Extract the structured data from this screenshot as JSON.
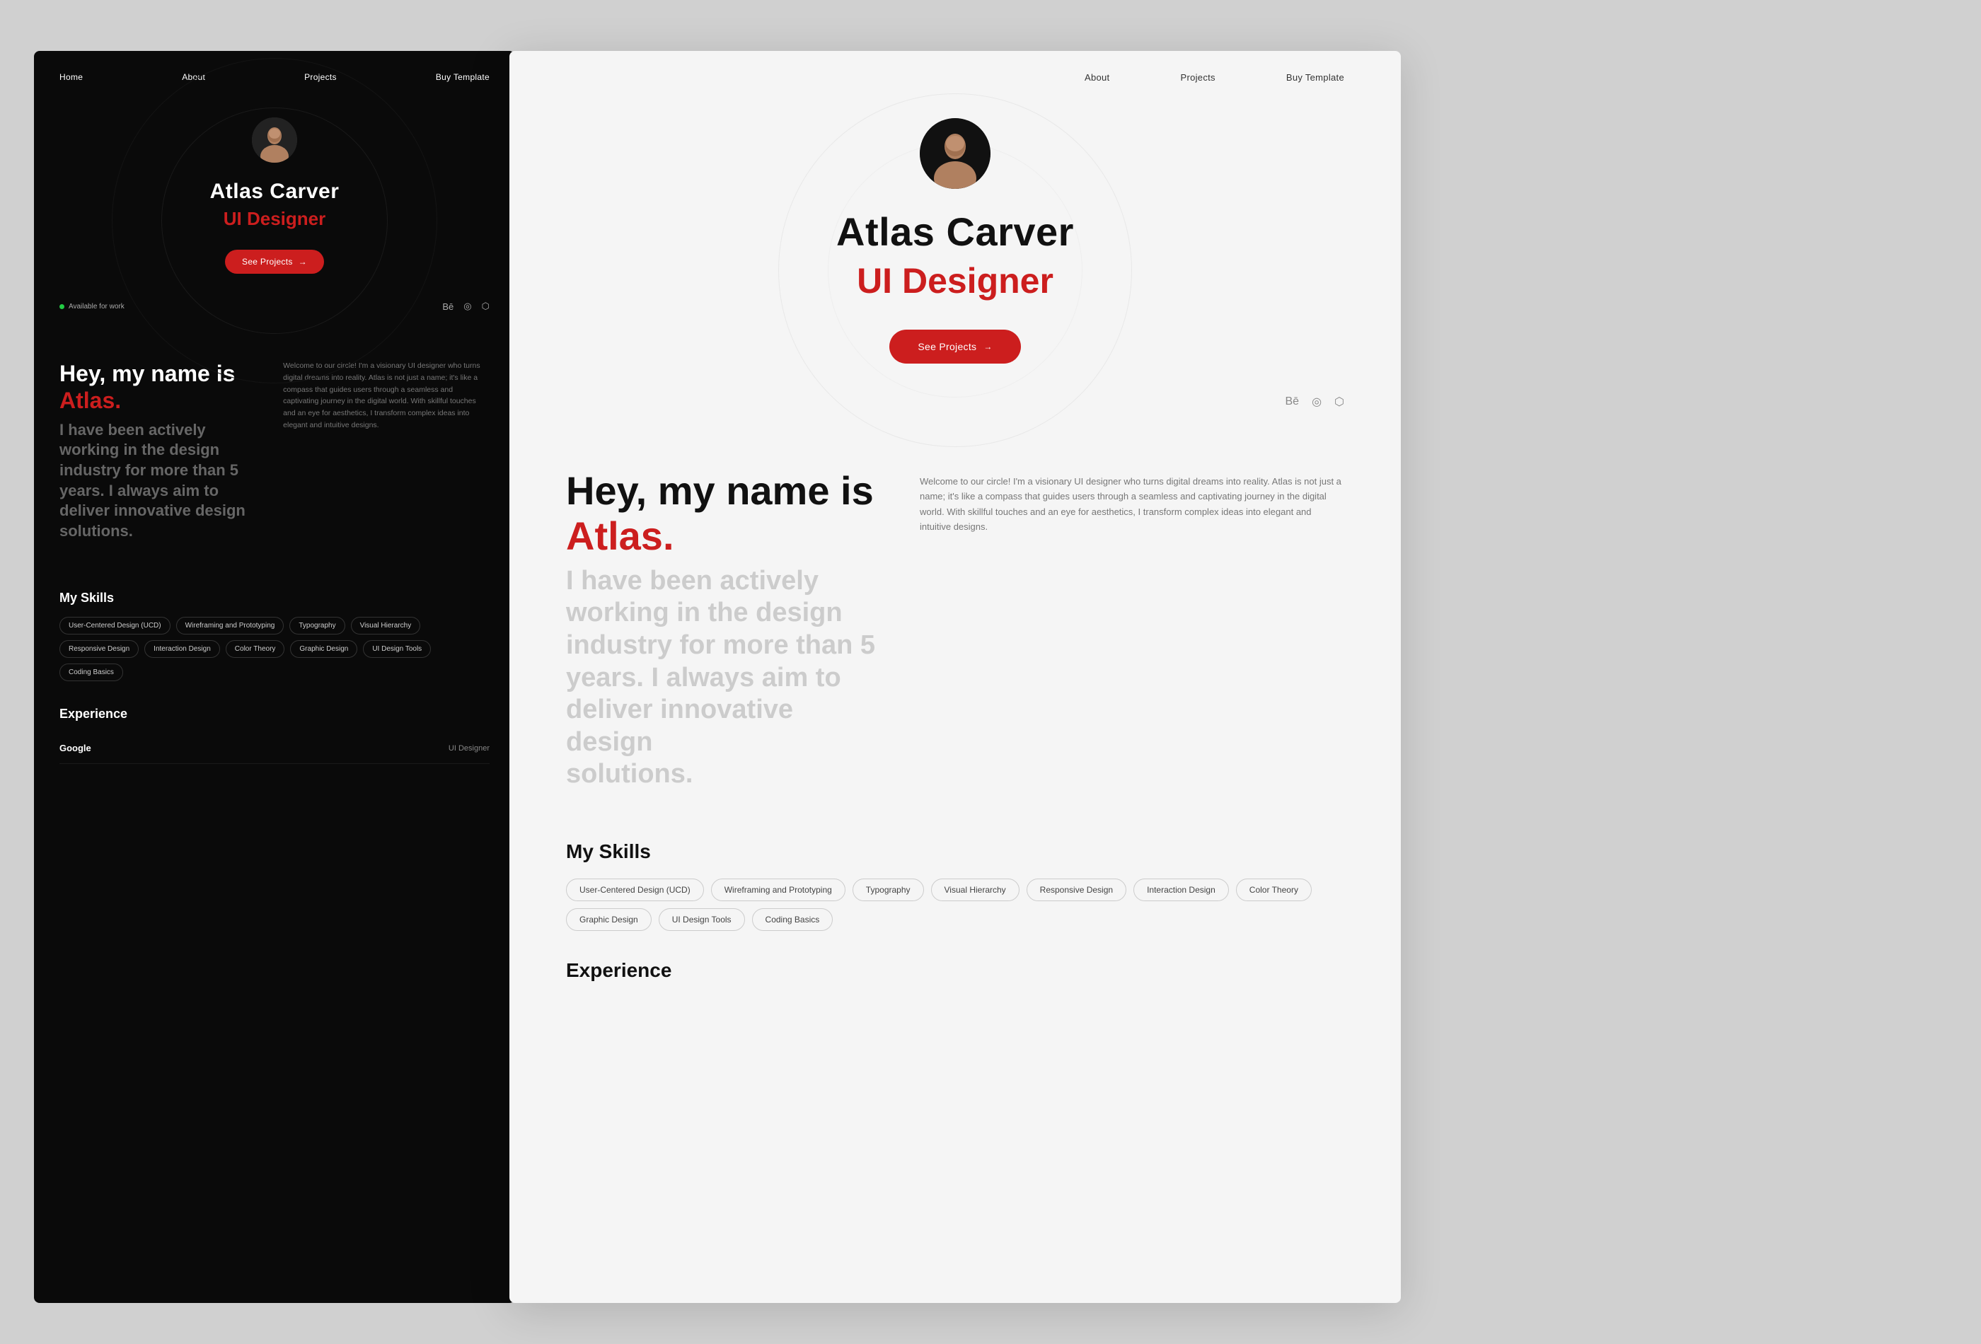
{
  "dark": {
    "nav": {
      "links": [
        "Home",
        "About",
        "Projects",
        "Buy Template"
      ]
    },
    "hero": {
      "name": "Atlas Carver",
      "title": "UI Designer",
      "btn_label": "See Projects",
      "arrow": "→"
    },
    "footer": {
      "available_label": "Available for work",
      "social": [
        "Bē",
        "⊕",
        "⊙"
      ]
    },
    "about": {
      "greeting": "Hey, my name is ",
      "highlight": "Atlas.",
      "subtitle_lines": [
        "I have been actively",
        "working in the design",
        "industry for more than 5",
        "years. I always aim to",
        "deliver innovative design",
        "solutions."
      ],
      "desc": "Welcome to our circle! I'm a visionary UI designer who turns digital dreams into reality. Atlas is not just a name; it's like a compass that guides users through a seamless and captivating journey in the digital world. With skillful touches and an eye for aesthetics, I transform complex ideas into elegant and intuitive designs."
    },
    "skills": {
      "title": "My Skills",
      "tags": [
        "User-Centered Design (UCD)",
        "Wireframing and Prototyping",
        "Typography",
        "Visual Hierarchy",
        "Responsive Design",
        "Interaction Design",
        "Color Theory",
        "Graphic Design",
        "UI Design Tools",
        "Coding Basics"
      ]
    },
    "experience": {
      "title": "Experience",
      "items": [
        {
          "company": "Google",
          "role": "UI Designer"
        }
      ]
    }
  },
  "light": {
    "nav": {
      "links": [
        "About",
        "Projects",
        "Buy Template"
      ]
    },
    "hero": {
      "name": "Atlas Carver",
      "title": "UI Designer",
      "btn_label": "See Projects",
      "arrow": "→"
    },
    "footer": {
      "social": [
        "Bē",
        "⊕",
        "⊙"
      ]
    },
    "about": {
      "greeting": "me is ",
      "highlight": "Atlas.",
      "subtitle_lines": [
        "actively",
        "the design",
        "more than 5",
        "ays aim to",
        "native design"
      ],
      "desc": "Welcome to our circle! I'm a visionary UI designer who turns digital dreams into reality. Atlas is not just a name; it's like a compass that guides users through a seamless and captivating journey in the digital world. With skillful touches and an eye for aesthetics, I transform complex ideas into elegant and intuitive designs."
    },
    "skills": {
      "title": "My Skills",
      "tags": [
        "User-Centered Design (UCD)",
        "Wireframing and Prototyping",
        "Typography",
        "Visual Hierarchy",
        "Responsive Design",
        "Interaction Design",
        "Color Theory",
        "Graphic Design",
        "UI Design Tools",
        "Coding Basics"
      ]
    },
    "experience": {
      "title": "Experience"
    }
  },
  "icons": {
    "behance": "Bē",
    "globe": "◎",
    "instagram": "⬡"
  }
}
